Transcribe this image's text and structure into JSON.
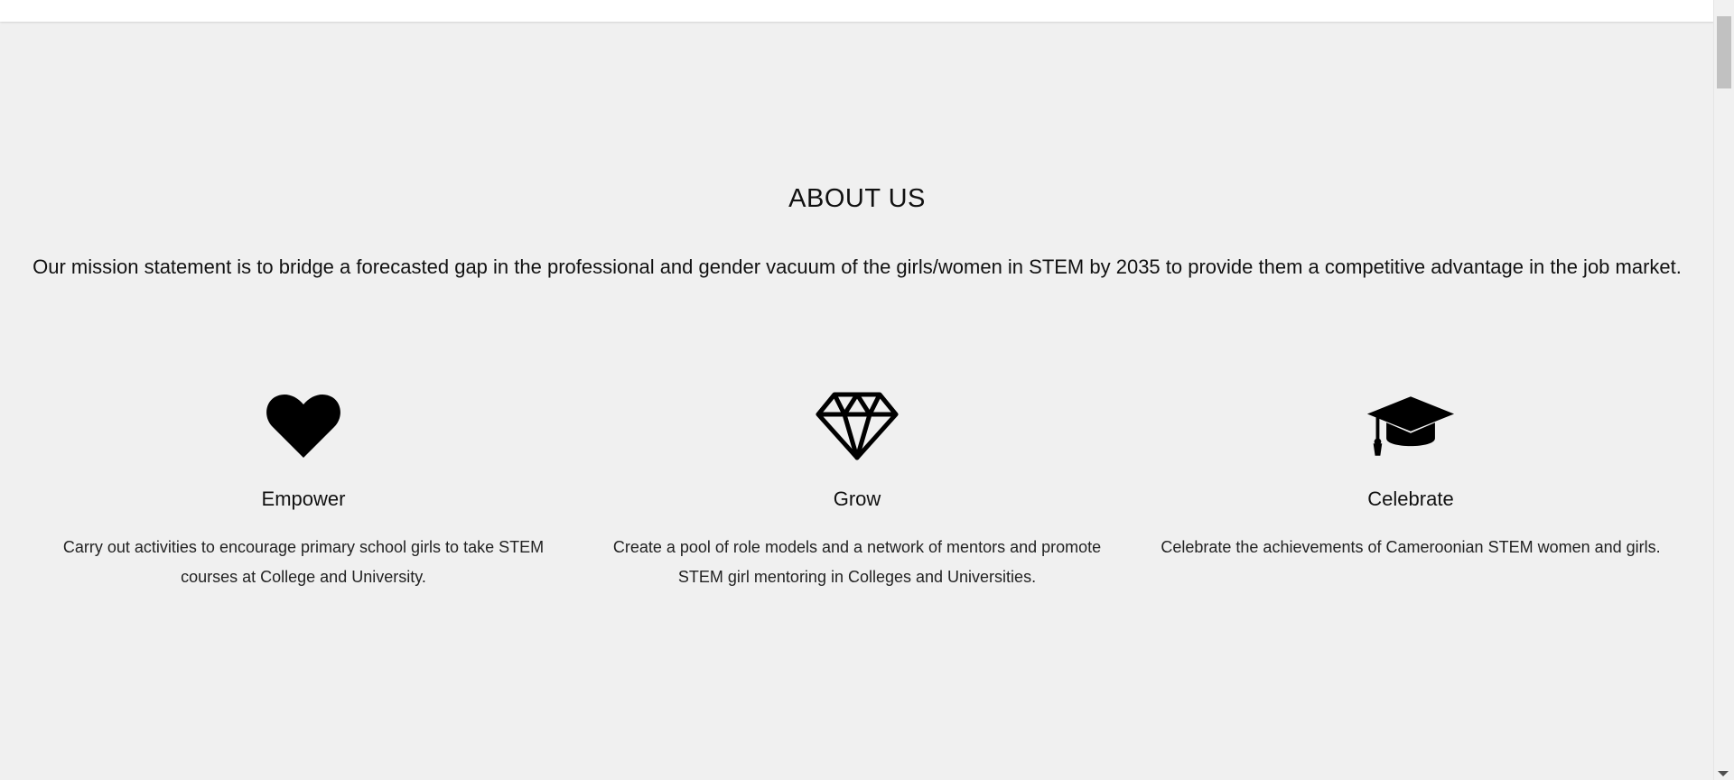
{
  "about": {
    "title": "ABOUT US",
    "mission": "Our mission statement is to bridge a forecasted gap in the professional and gender vacuum of the girls/women in STEM by 2035 to provide them a competitive advantage in the job market."
  },
  "features": [
    {
      "icon": "heart-icon",
      "title": "Empower",
      "description": "Carry out activities to encourage primary school girls to take STEM courses at College and University."
    },
    {
      "icon": "diamond-icon",
      "title": "Grow",
      "description": "Create a pool of role models and a network of mentors and promote STEM girl mentoring in Colleges and Universities."
    },
    {
      "icon": "graduation-cap-icon",
      "title": "Celebrate",
      "description": "Celebrate the achievements of Cameroonian STEM women and girls."
    }
  ],
  "colors": {
    "background": "#f0f0f0",
    "text": "#111111",
    "header": "#ffffff"
  }
}
